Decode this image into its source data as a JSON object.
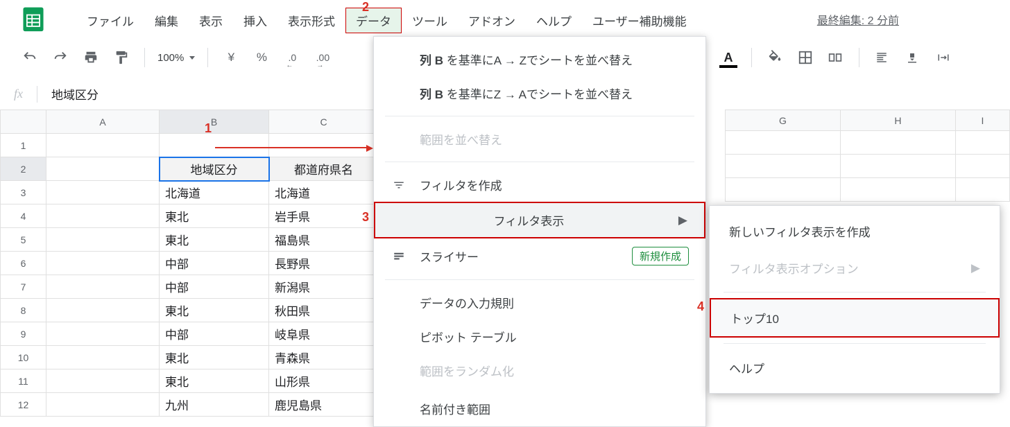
{
  "logo_color": "#0f9d58",
  "menubar": {
    "items": [
      "ファイル",
      "編集",
      "表示",
      "挿入",
      "表示形式",
      "データ",
      "ツール",
      "アドオン",
      "ヘルプ",
      "ユーザー補助機能"
    ],
    "selected_index": 5
  },
  "last_edit": "最終編集: 2 分前",
  "toolbar": {
    "zoom": "100%",
    "currency": "¥",
    "percent": "%",
    "dec_dec": ".0",
    "inc_dec": ".00"
  },
  "fx": {
    "label": "fx",
    "value": "地域区分"
  },
  "columns": [
    "A",
    "B",
    "C"
  ],
  "right_columns": [
    "G",
    "H",
    "I"
  ],
  "row_numbers": [
    "1",
    "2",
    "3",
    "4",
    "5",
    "6",
    "7",
    "8",
    "9",
    "10",
    "11",
    "12"
  ],
  "active_row": 2,
  "headers": {
    "b": "地域区分",
    "c": "都道府県名"
  },
  "rows": [
    {
      "b": "北海道",
      "c": "北海道"
    },
    {
      "b": "東北",
      "c": "岩手県"
    },
    {
      "b": "東北",
      "c": "福島県"
    },
    {
      "b": "中部",
      "c": "長野県"
    },
    {
      "b": "中部",
      "c": "新潟県"
    },
    {
      "b": "東北",
      "c": "秋田県"
    },
    {
      "b": "中部",
      "c": "岐阜県"
    },
    {
      "b": "東北",
      "c": "青森県"
    },
    {
      "b": "東北",
      "c": "山形県"
    },
    {
      "b": "九州",
      "c": "鹿児島県"
    }
  ],
  "data_menu": {
    "sort_az_prefix": "列 B",
    "sort_az_rest": " を基準にA → Zでシートを並べ替え",
    "sort_za_prefix": "列 B",
    "sort_za_rest": " を基準にZ → Aでシートを並べ替え",
    "sort_range": "範囲を並べ替え",
    "create_filter": "フィルタを作成",
    "filter_views": "フィルタ表示",
    "slicer": "スライサー",
    "slicer_badge": "新規作成",
    "data_validation": "データの入力規則",
    "pivot_table": "ピボット テーブル",
    "randomize": "範囲をランダム化",
    "named_ranges": "名前付き範囲"
  },
  "filter_submenu": {
    "create_new": "新しいフィルタ表示を作成",
    "options": "フィルタ表示オプション",
    "top10": "トップ10",
    "help": "ヘルプ"
  },
  "annotations": {
    "n1": "1",
    "n2": "2",
    "n3": "3",
    "n4": "4"
  }
}
